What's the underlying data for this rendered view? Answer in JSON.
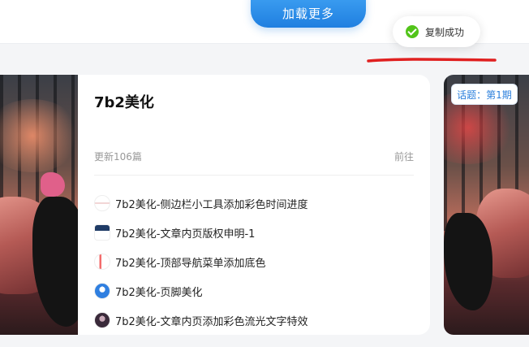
{
  "header": {
    "load_more_label": "加载更多"
  },
  "toast": {
    "message": "复制成功",
    "icon": "check-circle-icon",
    "color": "#52c41a"
  },
  "card": {
    "title": "7b2美化",
    "meta": "更新106篇",
    "go_label": "前往",
    "posts": [
      {
        "title": "7b2美化-侧边栏小工具添加彩色时间进度"
      },
      {
        "title": "7b2美化-文章内页版权申明-1"
      },
      {
        "title": "7b2美化-顶部导航菜单添加底色"
      },
      {
        "title": "7b2美化-页脚美化"
      },
      {
        "title": "7b2美化-文章内页添加彩色流光文字特效"
      }
    ]
  },
  "right_badge": {
    "label": "话题：第1期"
  },
  "colors": {
    "accent": "#1f7fe0",
    "success": "#52c41a",
    "annotation": "#e02020"
  }
}
